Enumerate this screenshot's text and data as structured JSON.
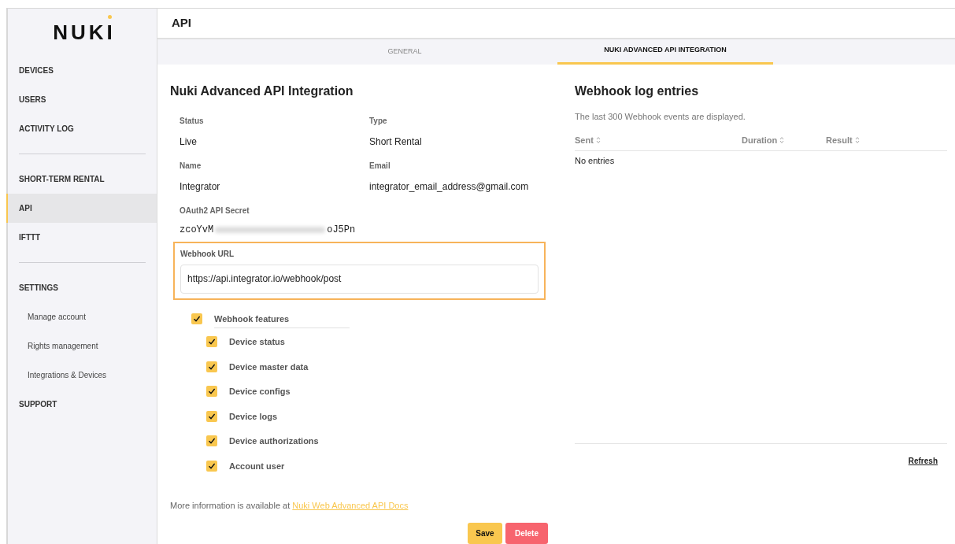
{
  "logo": {
    "text": "NUKI"
  },
  "sidebar": {
    "groups": [
      {
        "items": [
          {
            "label": "DEVICES",
            "kind": "section",
            "selected": false
          },
          {
            "label": "USERS",
            "kind": "section",
            "selected": false
          },
          {
            "label": "ACTIVITY LOG",
            "kind": "section",
            "selected": false
          }
        ]
      },
      {
        "items": [
          {
            "label": "SHORT-TERM RENTAL",
            "kind": "section",
            "selected": false
          },
          {
            "label": "API",
            "kind": "section",
            "selected": true
          },
          {
            "label": "IFTTT",
            "kind": "section",
            "selected": false
          }
        ]
      },
      {
        "items": [
          {
            "label": "SETTINGS",
            "kind": "section",
            "selected": false
          },
          {
            "label": "Manage account",
            "kind": "subitem",
            "selected": false
          },
          {
            "label": "Rights management",
            "kind": "subitem",
            "selected": false
          },
          {
            "label": "Integrations & Devices",
            "kind": "subitem",
            "selected": false
          },
          {
            "label": "SUPPORT",
            "kind": "section",
            "selected": false
          }
        ]
      }
    ]
  },
  "header": {
    "title": "API"
  },
  "tabs": [
    {
      "label": "GENERAL",
      "selected": false
    },
    {
      "label": "NUKI ADVANCED API INTEGRATION",
      "selected": true
    }
  ],
  "integration": {
    "title": "Nuki Advanced API Integration",
    "fields": [
      {
        "label": "Status",
        "value": "Live"
      },
      {
        "label": "Type",
        "value": "Short Rental"
      },
      {
        "label": "Name",
        "value": "Integrator"
      },
      {
        "label": "Email",
        "value": "integrator_email_address@gmail.com"
      }
    ],
    "secret": {
      "label": "OAuth2 API Secret",
      "visible_start": "zcoYvM",
      "visible_end": "oJ5Pn"
    },
    "webhook_url": {
      "label": "Webhook URL",
      "value": "https://api.integrator.io/webhook/post"
    },
    "features": {
      "label": "Webhook features",
      "checked": true,
      "children": [
        {
          "label": "Device status",
          "checked": true
        },
        {
          "label": "Device master data",
          "checked": true
        },
        {
          "label": "Device configs",
          "checked": true
        },
        {
          "label": "Device logs",
          "checked": true
        },
        {
          "label": "Device authorizations",
          "checked": true
        },
        {
          "label": "Account user",
          "checked": true
        }
      ]
    },
    "more_info": {
      "text": "More information is available at",
      "link": "Nuki Web Advanced API Docs"
    },
    "buttons": [
      {
        "label": "Save",
        "kind": "primary"
      },
      {
        "label": "Delete",
        "kind": "danger"
      }
    ]
  },
  "log": {
    "title": "Webhook log entries",
    "subtitle": "The last 300 Webhook events are displayed.",
    "columns": [
      "Sent",
      "Duration",
      "Result"
    ],
    "empty_text": "No entries",
    "refresh": "Refresh"
  }
}
